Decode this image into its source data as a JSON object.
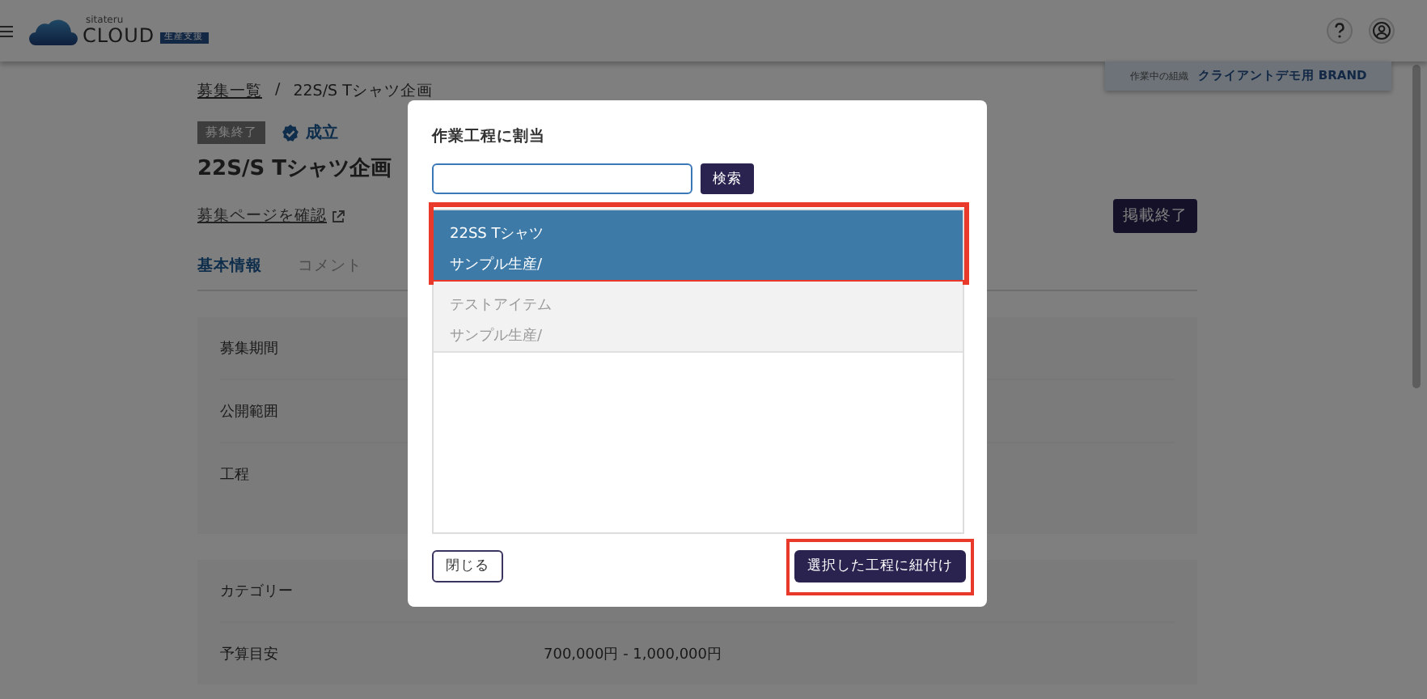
{
  "header": {
    "logo_tagline": "sitateru",
    "logo_text": "CLOUD",
    "logo_badge": "生産支援"
  },
  "org_badge": {
    "label": "作業中の組織",
    "name": "クライアントデモ用 BRAND"
  },
  "breadcrumb": [
    {
      "label": "募集一覧",
      "link": true
    },
    {
      "label": "/",
      "link": false
    },
    {
      "label": "22S/S Tシャツ企画",
      "link": false
    }
  ],
  "status_tag": "募集終了",
  "status": {
    "label": "成立"
  },
  "title": "22S/S Tシャツ企画",
  "page_link": "募集ページを確認",
  "end_button": "掲載終了",
  "tabs": [
    {
      "label": "基本情報",
      "selected": true
    },
    {
      "label": "コメント",
      "selected": false
    }
  ],
  "cards": [
    {
      "rows": [
        {
          "label": "募集期間"
        },
        {
          "label": "公開範囲"
        },
        {
          "label": "工程"
        }
      ]
    },
    {
      "rows": [
        {
          "label": "カテゴリー"
        },
        {
          "label": "予算目安",
          "value": "700,000円  -  1,000,000円"
        }
      ]
    }
  ],
  "dialog": {
    "title": "作業工程に割当",
    "search": {
      "button": "検索"
    },
    "items": [
      {
        "name": "22SS Tシャツ",
        "sub": "サンプル生産/",
        "selected": true,
        "highlighted": true
      },
      {
        "name": "テストアイテム",
        "sub": "サンプル生産/",
        "selected": false,
        "highlighted": false
      }
    ],
    "close_button": "閉じる",
    "confirm_button": {
      "label": "選択した工程に紐付け",
      "highlighted": true
    }
  }
}
